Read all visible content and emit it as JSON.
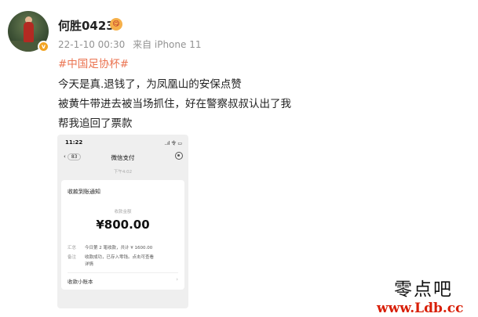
{
  "post": {
    "username": "何胜0423",
    "badge_emoji": "😋",
    "timestamp": "22-1-10 00:30",
    "source": "来自 iPhone 11",
    "hashtag": "#中国足协杯#",
    "lines": [
      "今天是真.退钱了，为凤凰山的安保点赞",
      "被黄牛带进去被当场抓住，好在警察叔叔认出了我",
      "帮我追回了票款"
    ]
  },
  "screenshot": {
    "status_time": "11:22",
    "status_icons": "..ıl 令 ▭",
    "back_count": "83",
    "title": "微信支付",
    "stamp": "下午4:02",
    "card_title": "收款到账通知",
    "amount_label": "收款金额",
    "amount": "¥800.00",
    "rows": [
      {
        "label": "汇总",
        "value": "今日第 2 笔收款，共计 ¥ 1600.00"
      },
      {
        "label": "备注",
        "value": "收款成功，已存入零钱。点击可查看"
      }
    ],
    "row2_cont": "详情",
    "ledger": "收款小账本",
    "ledger_arrow": "›"
  },
  "watermark": {
    "chinese": "零点吧",
    "url": "www.Ldb.cc"
  },
  "colors": {
    "hashtag": "#eb7350",
    "verified": "#f2a423",
    "watermark_url": "#d81e06"
  }
}
